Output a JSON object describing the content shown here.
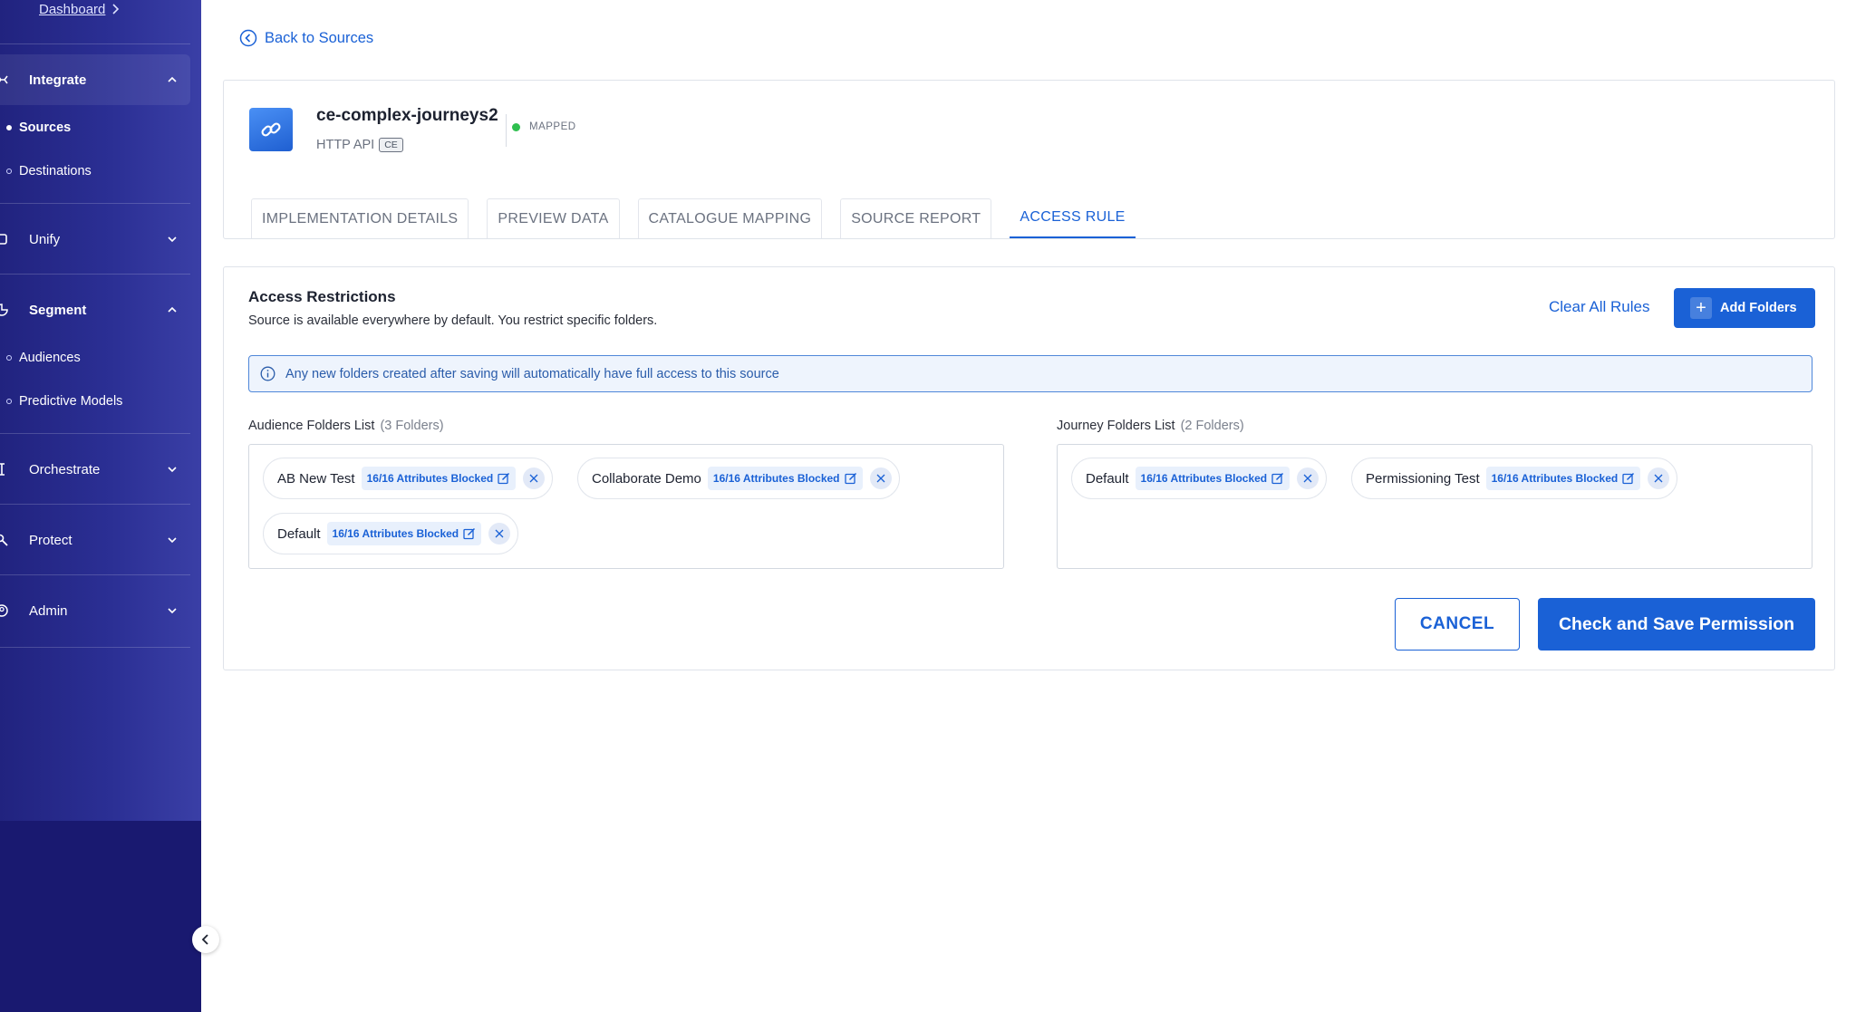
{
  "sidebar": {
    "breadcrumb": "Dashboard",
    "sections": {
      "integrate": "Integrate",
      "unify": "Unify",
      "segment": "Segment",
      "orchestrate": "Orchestrate",
      "protect": "Protect",
      "admin": "Admin"
    },
    "items": {
      "sources": "Sources",
      "destinations": "Destinations",
      "audiences": "Audiences",
      "predictive_models": "Predictive Models"
    }
  },
  "back_link": "Back to Sources",
  "source": {
    "name": "ce-complex-journeys2",
    "type": "HTTP API",
    "badge": "CE",
    "status": "MAPPED",
    "status_color": "#2fbf4f"
  },
  "tabs": [
    {
      "label": "IMPLEMENTATION DETAILS",
      "active": false
    },
    {
      "label": "PREVIEW DATA",
      "active": false
    },
    {
      "label": "CATALOGUE MAPPING",
      "active": false
    },
    {
      "label": "SOURCE REPORT",
      "active": false
    },
    {
      "label": "ACCESS RULE",
      "active": true
    }
  ],
  "access": {
    "title": "Access Restrictions",
    "subtitle": "Source is available everywhere by default. You restrict specific folders.",
    "clear_all": "Clear All Rules",
    "add_folders": "Add Folders",
    "info": "Any new folders created after saving will automatically have full access to this source",
    "audience": {
      "heading": "Audience Folders List",
      "count": "(3 Folders)",
      "folders": [
        {
          "name": "AB New Test",
          "attr": "16/16 Attributes Blocked"
        },
        {
          "name": "Collaborate Demo",
          "attr": "16/16 Attributes Blocked"
        },
        {
          "name": "Default",
          "attr": "16/16 Attributes Blocked"
        }
      ]
    },
    "journey": {
      "heading": "Journey Folders List",
      "count": "(2 Folders)",
      "folders": [
        {
          "name": "Default",
          "attr": "16/16 Attributes Blocked"
        },
        {
          "name": "Permissioning Test",
          "attr": "16/16 Attributes Blocked"
        }
      ]
    },
    "cancel": "CANCEL",
    "save": "Check and Save Permission"
  },
  "colors": {
    "sidebar": "#191970",
    "accent": "#1a61d6"
  }
}
